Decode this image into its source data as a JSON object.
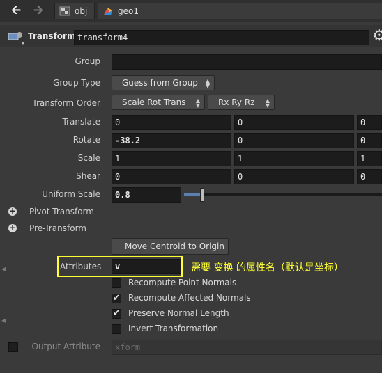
{
  "pathbar": {
    "crumbs": [
      {
        "label": "obj",
        "icon": "obj-network-icon"
      },
      {
        "label": "geo1",
        "icon": "geo-node-icon"
      }
    ]
  },
  "header": {
    "node_type": "Transform",
    "node_name": "transform4"
  },
  "params": {
    "group": {
      "label": "Group",
      "value": ""
    },
    "group_type": {
      "label": "Group Type",
      "value": "Guess from Group"
    },
    "transform_order": {
      "label": "Transform Order",
      "value": "Scale Rot Trans",
      "rot_value": "Rx Ry Rz"
    },
    "translate": {
      "label": "Translate",
      "values": [
        "0",
        "0",
        "0"
      ]
    },
    "rotate": {
      "label": "Rotate",
      "values": [
        "-38.2",
        "0",
        "0"
      ]
    },
    "scale": {
      "label": "Scale",
      "values": [
        "1",
        "1",
        "1"
      ]
    },
    "shear": {
      "label": "Shear",
      "values": [
        "0",
        "0",
        "0"
      ]
    },
    "uniform_scale": {
      "label": "Uniform Scale",
      "value": "0.8",
      "slider_fraction": 0.08
    },
    "pivot_transform": "Pivot Transform",
    "pre_transform": "Pre-Transform",
    "move_centroid": "Move Centroid to Origin",
    "attributes": {
      "label": "Attributes",
      "value": "v"
    },
    "annotation": "需要 变换 的属性名（默认是坐标）",
    "recompute_point_normals": {
      "label": "Recompute Point Normals",
      "checked": false
    },
    "recompute_affected_normals": {
      "label": "Recompute Affected Normals",
      "checked": true
    },
    "preserve_normal_length": {
      "label": "Preserve Normal Length",
      "checked": true
    },
    "invert_transformation": {
      "label": "Invert Transformation",
      "checked": false
    },
    "output_attribute": {
      "label": "Output Attribute",
      "value": "xform",
      "enabled": false
    }
  },
  "colors": {
    "highlight_box": "#ffff33",
    "annotation_text": "#ffff33",
    "panel_bg": "#3a3a3a",
    "field_bg": "#1c1c1c"
  }
}
